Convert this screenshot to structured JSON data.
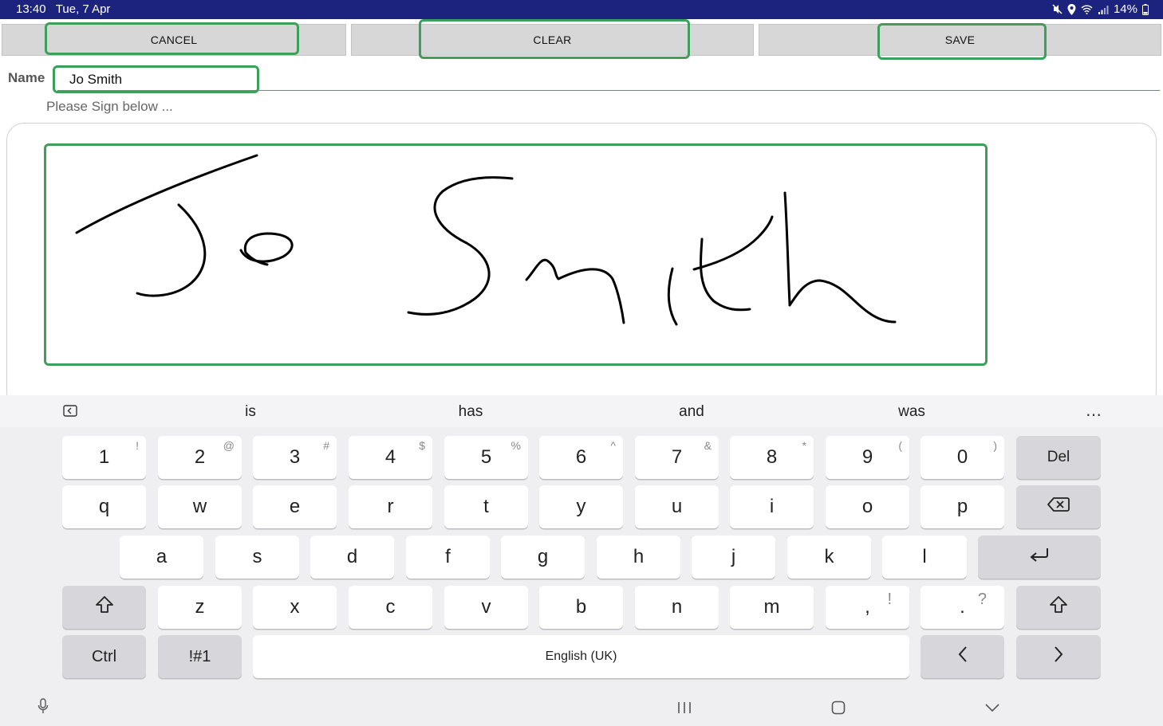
{
  "status_bar": {
    "time": "13:40",
    "date": "Tue, 7 Apr",
    "battery": "14%"
  },
  "toolbar": {
    "cancel_label": "CANCEL",
    "clear_label": "CLEAR",
    "save_label": "SAVE"
  },
  "form": {
    "name_label": "Name",
    "name_value": "Jo Smith",
    "sign_prompt": "Please Sign below ..."
  },
  "signature": {
    "alt": "Jo Smith"
  },
  "keyboard": {
    "suggestions": [
      "is",
      "has",
      "and",
      "was"
    ],
    "number_row": [
      {
        "main": "1",
        "sup": "!"
      },
      {
        "main": "2",
        "sup": "@"
      },
      {
        "main": "3",
        "sup": "#"
      },
      {
        "main": "4",
        "sup": "$"
      },
      {
        "main": "5",
        "sup": "%"
      },
      {
        "main": "6",
        "sup": "^"
      },
      {
        "main": "7",
        "sup": "&"
      },
      {
        "main": "8",
        "sup": "*"
      },
      {
        "main": "9",
        "sup": "("
      },
      {
        "main": "0",
        "sup": ")"
      }
    ],
    "del_label": "Del",
    "row_q": [
      "q",
      "w",
      "e",
      "r",
      "t",
      "y",
      "u",
      "i",
      "o",
      "p"
    ],
    "row_a": [
      "a",
      "s",
      "d",
      "f",
      "g",
      "h",
      "j",
      "k",
      "l"
    ],
    "row_z": [
      "z",
      "x",
      "c",
      "v",
      "b",
      "n",
      "m"
    ],
    "comma": {
      "main": ",",
      "sup": "!"
    },
    "period": {
      "main": ".",
      "sup": "?"
    },
    "ctrl_label": "Ctrl",
    "symbols_label": "!#1",
    "space_label": "English (UK)"
  },
  "colors": {
    "status_bar": "#1c237e",
    "highlight": "#3e9e5b",
    "name_underline": "#7678d8"
  }
}
